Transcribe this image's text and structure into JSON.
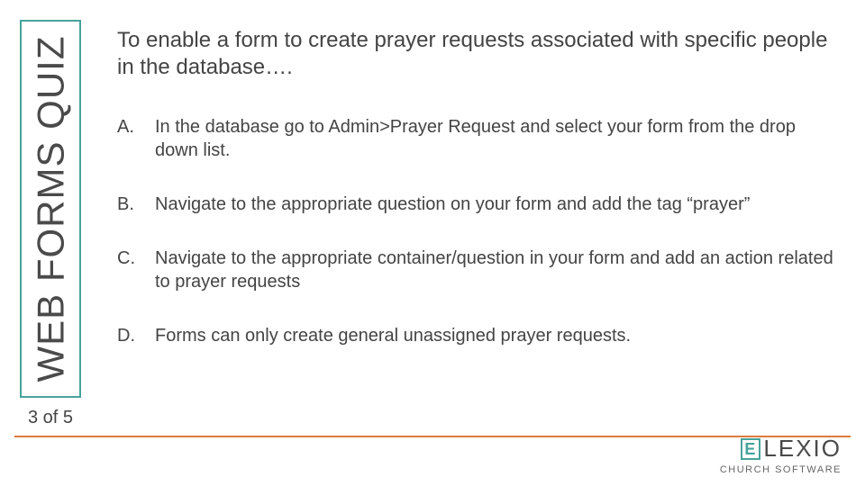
{
  "sidebar": {
    "title": "WEB FORMS QUIZ"
  },
  "question": "To enable a form to create prayer requests associated with specific people in the database….",
  "options": [
    {
      "letter": "A.",
      "text": "In the database go to Admin>Prayer Request and select your form from the drop down list."
    },
    {
      "letter": "B.",
      "text": "Navigate to the appropriate question on your form and add the tag “prayer”"
    },
    {
      "letter": "C.",
      "text": "Navigate to the appropriate container/question in your form and add an action related to prayer requests"
    },
    {
      "letter": "D.",
      "text": "Forms can only create general unassigned prayer requests."
    }
  ],
  "pager": "3 of 5",
  "logo": {
    "brand_rest": "LEXIO",
    "sub": "CHURCH SOFTWARE",
    "e": "E"
  }
}
